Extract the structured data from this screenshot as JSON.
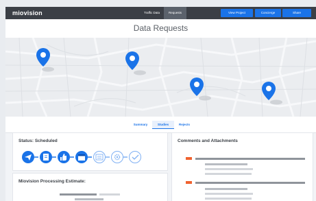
{
  "app": {
    "logo_text": "miovision",
    "nav": [
      {
        "label": "Traffic Data",
        "active": false
      },
      {
        "label": "Requests",
        "active": true
      }
    ],
    "buttons": {
      "view_project": "View Project",
      "concierge": "Concierge",
      "share": "Share"
    }
  },
  "page": {
    "title": "Data Requests"
  },
  "map": {
    "pins": [
      {
        "name": "location-pin",
        "icon": "map-pin-icon"
      },
      {
        "name": "location-pin",
        "icon": "map-pin-icon"
      },
      {
        "name": "location-pin",
        "icon": "map-pin-icon"
      },
      {
        "name": "location-pin",
        "icon": "map-pin-icon"
      }
    ],
    "pin_color": "#1a73e8"
  },
  "tabs": [
    {
      "label": "Summary",
      "active": false
    },
    {
      "label": "Studies",
      "active": true
    },
    {
      "label": "Rejects",
      "active": false
    }
  ],
  "status_card": {
    "heading": "Status: Scheduled",
    "steps": [
      {
        "icon": "paper-plane-icon",
        "state": "complete"
      },
      {
        "icon": "document-icon",
        "state": "complete"
      },
      {
        "icon": "thumbs-up-icon",
        "state": "complete"
      },
      {
        "icon": "calendar-icon",
        "state": "current"
      },
      {
        "icon": "video-reel-icon",
        "state": "pending"
      },
      {
        "icon": "gear-icon",
        "state": "pending"
      },
      {
        "icon": "checkmark-icon",
        "state": "pending"
      }
    ],
    "colors": {
      "active": "#1a73e8",
      "pending": "#7fb0f3"
    }
  },
  "processing_card": {
    "heading": "Miovision Processing Estimate:"
  },
  "comments_card": {
    "heading": "Comments and Attachments",
    "accent": "#f0622f"
  }
}
